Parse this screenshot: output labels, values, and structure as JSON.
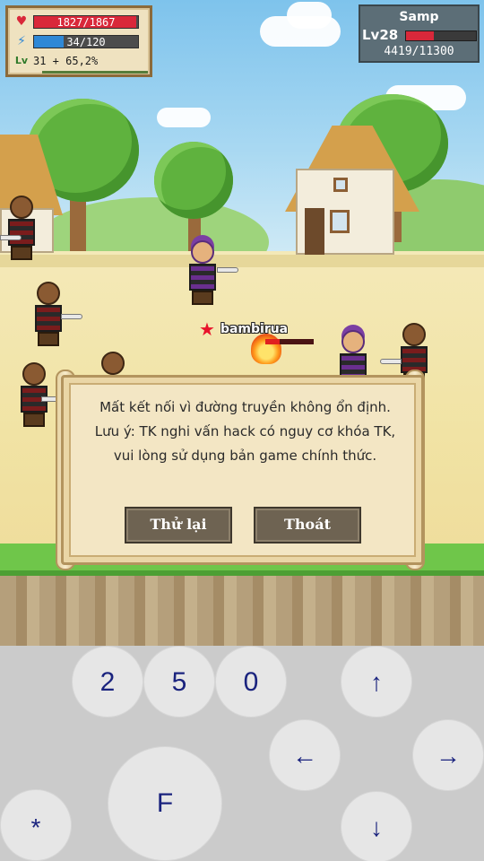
{
  "hud": {
    "hp_text": "1827/1867",
    "hp_fraction": 0.9786,
    "mp_text": "34/120",
    "mp_fraction": 0.2833,
    "level_text": "31 + 65,2%",
    "level_icon_label": "Lv",
    "hp_icon": "heart-icon",
    "mp_icon": "lightning-icon",
    "colors": {
      "hp": "#d9283a",
      "mp": "#2f88d6"
    }
  },
  "target": {
    "name": "Samp",
    "level": "Lv28",
    "hp_text": "4419/11300",
    "hp_fraction": 0.3911
  },
  "scene": {
    "player_name": "bambirua",
    "star_icon": "star-icon"
  },
  "dialog": {
    "line1": "Mất kết nối vì đường truyền không ổn định.",
    "line2": "Lưu ý: TK nghi vấn hack có nguy cơ khóa TK, vui lòng sử dụng bản game chính thức.",
    "retry_label": "Thử lại",
    "exit_label": "Thoát"
  },
  "controls": {
    "key_2": "2",
    "key_5": "5",
    "key_0": "0",
    "up": "↑",
    "left": "←",
    "right": "→",
    "down": "↓",
    "fire": "F",
    "star": "*"
  }
}
